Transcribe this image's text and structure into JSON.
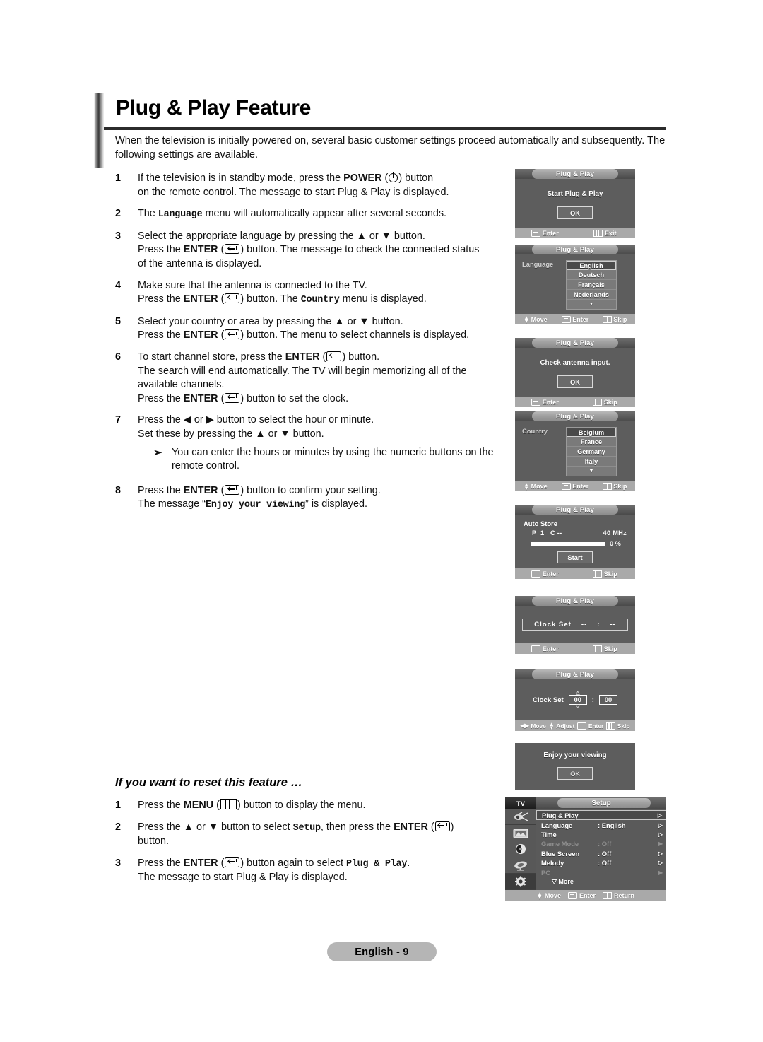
{
  "page": {
    "title": "Plug & Play Feature",
    "intro": "When the television is initially powered on, several basic customer settings proceed automatically and subsequently. The following settings are available.",
    "subheading": "If you want to reset this feature …",
    "footer_badge": "English - 9"
  },
  "steps": [
    {
      "num": "1",
      "lines": [
        {
          "parts": [
            {
              "t": "text",
              "v": "If the television is in standby mode, press the "
            },
            {
              "t": "bold",
              "v": "POWER"
            },
            {
              "t": "text",
              "v": " ("
            },
            {
              "t": "icon",
              "v": "power-icon"
            },
            {
              "t": "text",
              "v": ") button"
            }
          ]
        },
        {
          "parts": [
            {
              "t": "text",
              "v": "on the remote control. The message to start Plug & Play is displayed."
            }
          ]
        }
      ]
    },
    {
      "num": "2",
      "lines": [
        {
          "parts": [
            {
              "t": "text",
              "v": "The "
            },
            {
              "t": "mono",
              "v": "Language"
            },
            {
              "t": "text",
              "v": " menu will automatically appear after several seconds."
            }
          ]
        }
      ]
    },
    {
      "num": "3",
      "lines": [
        {
          "parts": [
            {
              "t": "text",
              "v": "Select the appropriate language by pressing the ▲ or ▼ button."
            }
          ]
        },
        {
          "parts": [
            {
              "t": "text",
              "v": "Press the "
            },
            {
              "t": "bold",
              "v": "ENTER"
            },
            {
              "t": "text",
              "v": " ("
            },
            {
              "t": "icon",
              "v": "enter-icon"
            },
            {
              "t": "text",
              "v": ") button. The message to check the connected status"
            }
          ]
        },
        {
          "parts": [
            {
              "t": "text",
              "v": "of the antenna is displayed."
            }
          ]
        }
      ]
    },
    {
      "num": "4",
      "lines": [
        {
          "parts": [
            {
              "t": "text",
              "v": "Make sure that the antenna is connected to the TV."
            }
          ]
        },
        {
          "parts": [
            {
              "t": "text",
              "v": "Press the "
            },
            {
              "t": "bold",
              "v": "ENTER"
            },
            {
              "t": "text",
              "v": " ("
            },
            {
              "t": "icon",
              "v": "enter-icon"
            },
            {
              "t": "text",
              "v": ") button. The "
            },
            {
              "t": "mono",
              "v": "Country"
            },
            {
              "t": "text",
              "v": " menu is displayed."
            }
          ]
        }
      ]
    },
    {
      "num": "5",
      "lines": [
        {
          "parts": [
            {
              "t": "text",
              "v": "Select your country or area by pressing the ▲ or ▼ button."
            }
          ]
        },
        {
          "parts": [
            {
              "t": "text",
              "v": "Press the "
            },
            {
              "t": "bold",
              "v": "ENTER"
            },
            {
              "t": "text",
              "v": " ("
            },
            {
              "t": "icon",
              "v": "enter-icon"
            },
            {
              "t": "text",
              "v": ") button. The menu to select channels is displayed."
            }
          ]
        }
      ]
    },
    {
      "num": "6",
      "lines": [
        {
          "parts": [
            {
              "t": "text",
              "v": "To start channel store, press the "
            },
            {
              "t": "bold",
              "v": "ENTER"
            },
            {
              "t": "text",
              "v": " ("
            },
            {
              "t": "icon",
              "v": "enter-icon"
            },
            {
              "t": "text",
              "v": ") button."
            }
          ]
        },
        {
          "parts": [
            {
              "t": "text",
              "v": "The search will end automatically. The TV will begin memorizing all of the"
            }
          ]
        },
        {
          "parts": [
            {
              "t": "text",
              "v": "available channels."
            }
          ]
        },
        {
          "parts": [
            {
              "t": "text",
              "v": "Press the "
            },
            {
              "t": "bold",
              "v": "ENTER"
            },
            {
              "t": "text",
              "v": " ("
            },
            {
              "t": "icon",
              "v": "enter-icon"
            },
            {
              "t": "text",
              "v": ") button to set the clock."
            }
          ]
        }
      ]
    },
    {
      "num": "7",
      "lines": [
        {
          "parts": [
            {
              "t": "text",
              "v": "Press the ◀ or ▶ button to select the hour or minute."
            }
          ]
        },
        {
          "parts": [
            {
              "t": "text",
              "v": "Set these by pressing the ▲ or ▼ button."
            }
          ]
        }
      ],
      "note": {
        "arrow": "➢",
        "lines": [
          "You can enter the hours or minutes by using the numeric buttons on the",
          "remote control."
        ]
      }
    },
    {
      "num": "8",
      "lines": [
        {
          "parts": [
            {
              "t": "text",
              "v": "Press the "
            },
            {
              "t": "bold",
              "v": "ENTER"
            },
            {
              "t": "text",
              "v": " ("
            },
            {
              "t": "icon",
              "v": "enter-icon"
            },
            {
              "t": "text",
              "v": ") button to confirm your setting."
            }
          ]
        },
        {
          "parts": [
            {
              "t": "text",
              "v": "The message “"
            },
            {
              "t": "mono",
              "v": "Enjoy your viewing"
            },
            {
              "t": "text",
              "v": "” is displayed."
            }
          ]
        }
      ]
    }
  ],
  "reset_steps": [
    {
      "num": "1",
      "lines": [
        {
          "parts": [
            {
              "t": "text",
              "v": "Press the "
            },
            {
              "t": "bold",
              "v": "MENU"
            },
            {
              "t": "text",
              "v": " ("
            },
            {
              "t": "icon",
              "v": "menu-icon"
            },
            {
              "t": "text",
              "v": ") button to display the menu."
            }
          ]
        }
      ]
    },
    {
      "num": "2",
      "lines": [
        {
          "parts": [
            {
              "t": "text",
              "v": "Press the ▲ or ▼ button to select "
            },
            {
              "t": "mono",
              "v": "Setup"
            },
            {
              "t": "text",
              "v": ", then press the "
            },
            {
              "t": "bold",
              "v": "ENTER"
            },
            {
              "t": "text",
              "v": " ("
            },
            {
              "t": "icon",
              "v": "enter-icon"
            },
            {
              "t": "text",
              "v": ")"
            }
          ]
        },
        {
          "parts": [
            {
              "t": "text",
              "v": "button."
            }
          ]
        }
      ]
    },
    {
      "num": "3",
      "lines": [
        {
          "parts": [
            {
              "t": "text",
              "v": "Press the "
            },
            {
              "t": "bold",
              "v": "ENTER"
            },
            {
              "t": "text",
              "v": " ("
            },
            {
              "t": "icon",
              "v": "enter-icon"
            },
            {
              "t": "text",
              "v": ") button again to select "
            },
            {
              "t": "mono",
              "v": "Plug & Play"
            },
            {
              "t": "text",
              "v": "."
            }
          ]
        },
        {
          "parts": [
            {
              "t": "text",
              "v": "The message to start Plug & Play is displayed."
            }
          ]
        }
      ]
    }
  ],
  "osd": {
    "common_title": "Plug & Play",
    "panel1": {
      "title": "Plug & Play",
      "message": "Start Plug & Play",
      "ok_label": "OK",
      "footer": [
        {
          "icon": "enter-icon",
          "label": "Enter"
        },
        {
          "icon": "menu-icon",
          "label": "Exit"
        }
      ]
    },
    "panel2": {
      "title": "Plug & Play",
      "label": "Language",
      "items": [
        "English",
        "Deutsch",
        "Français",
        "Nederlands"
      ],
      "selected": "English",
      "more_glyph": "▼",
      "footer": [
        {
          "icon": "updown-icon",
          "label": "Move"
        },
        {
          "icon": "enter-icon",
          "label": "Enter"
        },
        {
          "icon": "menu-icon",
          "label": "Skip"
        }
      ]
    },
    "panel3": {
      "title": "Plug & Play",
      "message": "Check antenna input.",
      "ok_label": "OK",
      "footer": [
        {
          "icon": "enter-icon",
          "label": "Enter"
        },
        {
          "icon": "menu-icon",
          "label": "Skip"
        }
      ]
    },
    "panel4": {
      "title": "Plug & Play",
      "label": "Country",
      "items": [
        "Belgium",
        "France",
        "Germany",
        "Italy"
      ],
      "selected": "Belgium",
      "more_glyph": "▼",
      "footer": [
        {
          "icon": "updown-icon",
          "label": "Move"
        },
        {
          "icon": "enter-icon",
          "label": "Enter"
        },
        {
          "icon": "menu-icon",
          "label": "Skip"
        }
      ]
    },
    "panel5": {
      "title": "Plug & Play",
      "heading": "Auto Store",
      "prog_p": "P",
      "prog_p_val": "1",
      "prog_c": "C",
      "prog_c_val": "--",
      "freq": "40 MHz",
      "percent": "0 %",
      "progress_value": 0,
      "start_label": "Start",
      "footer": [
        {
          "icon": "enter-icon",
          "label": "Enter"
        },
        {
          "icon": "menu-icon",
          "label": "Skip"
        }
      ]
    },
    "panel6": {
      "title": "Plug & Play",
      "clock_label": "Clock Set",
      "hour": "--",
      "colon": ":",
      "minute": "--",
      "footer": [
        {
          "icon": "enter-icon",
          "label": "Enter"
        },
        {
          "icon": "menu-icon",
          "label": "Skip"
        }
      ]
    },
    "panel7": {
      "title": "Plug & Play",
      "clock_label": "Clock Set",
      "hour": "00",
      "colon": ":",
      "minute": "00",
      "up_caret": "△",
      "down_caret": "▽",
      "footer": [
        {
          "icon": "leftright-icon",
          "label": "Move"
        },
        {
          "icon": "updown-icon",
          "label": "Adjust"
        },
        {
          "icon": "enter-icon",
          "label": "Enter"
        },
        {
          "icon": "menu-icon",
          "label": "Skip"
        }
      ]
    },
    "panel8": {
      "message": "Enjoy your viewing",
      "ok_label": "OK"
    }
  },
  "setup_menu": {
    "source_label": "TV",
    "title": "Setup",
    "side_icons": [
      "input-icon",
      "picture-icon",
      "sound-icon",
      "channel-icon",
      "setup-gear-icon"
    ],
    "active_side_icon": "setup-gear-icon",
    "rows": [
      {
        "name": "Plug & Play",
        "value": "",
        "chev": "▷",
        "selected": true,
        "dim": false
      },
      {
        "name": "Language",
        "value": ": English",
        "chev": "▷",
        "selected": false,
        "dim": false
      },
      {
        "name": "Time",
        "value": "",
        "chev": "▷",
        "selected": false,
        "dim": false
      },
      {
        "name": "Game Mode",
        "value": ": Off",
        "chev": "▶",
        "selected": false,
        "dim": true
      },
      {
        "name": "Blue Screen",
        "value": ": Off",
        "chev": "▷",
        "selected": false,
        "dim": false
      },
      {
        "name": "Melody",
        "value": ": Off",
        "chev": "▷",
        "selected": false,
        "dim": false
      },
      {
        "name": "PC",
        "value": "",
        "chev": "▶",
        "selected": false,
        "dim": true
      }
    ],
    "more_label": "▽ More",
    "footer": [
      {
        "icon": "updown-icon",
        "label": "Move"
      },
      {
        "icon": "enter-icon",
        "label": "Enter"
      },
      {
        "icon": "menu-icon",
        "label": "Return"
      }
    ]
  }
}
